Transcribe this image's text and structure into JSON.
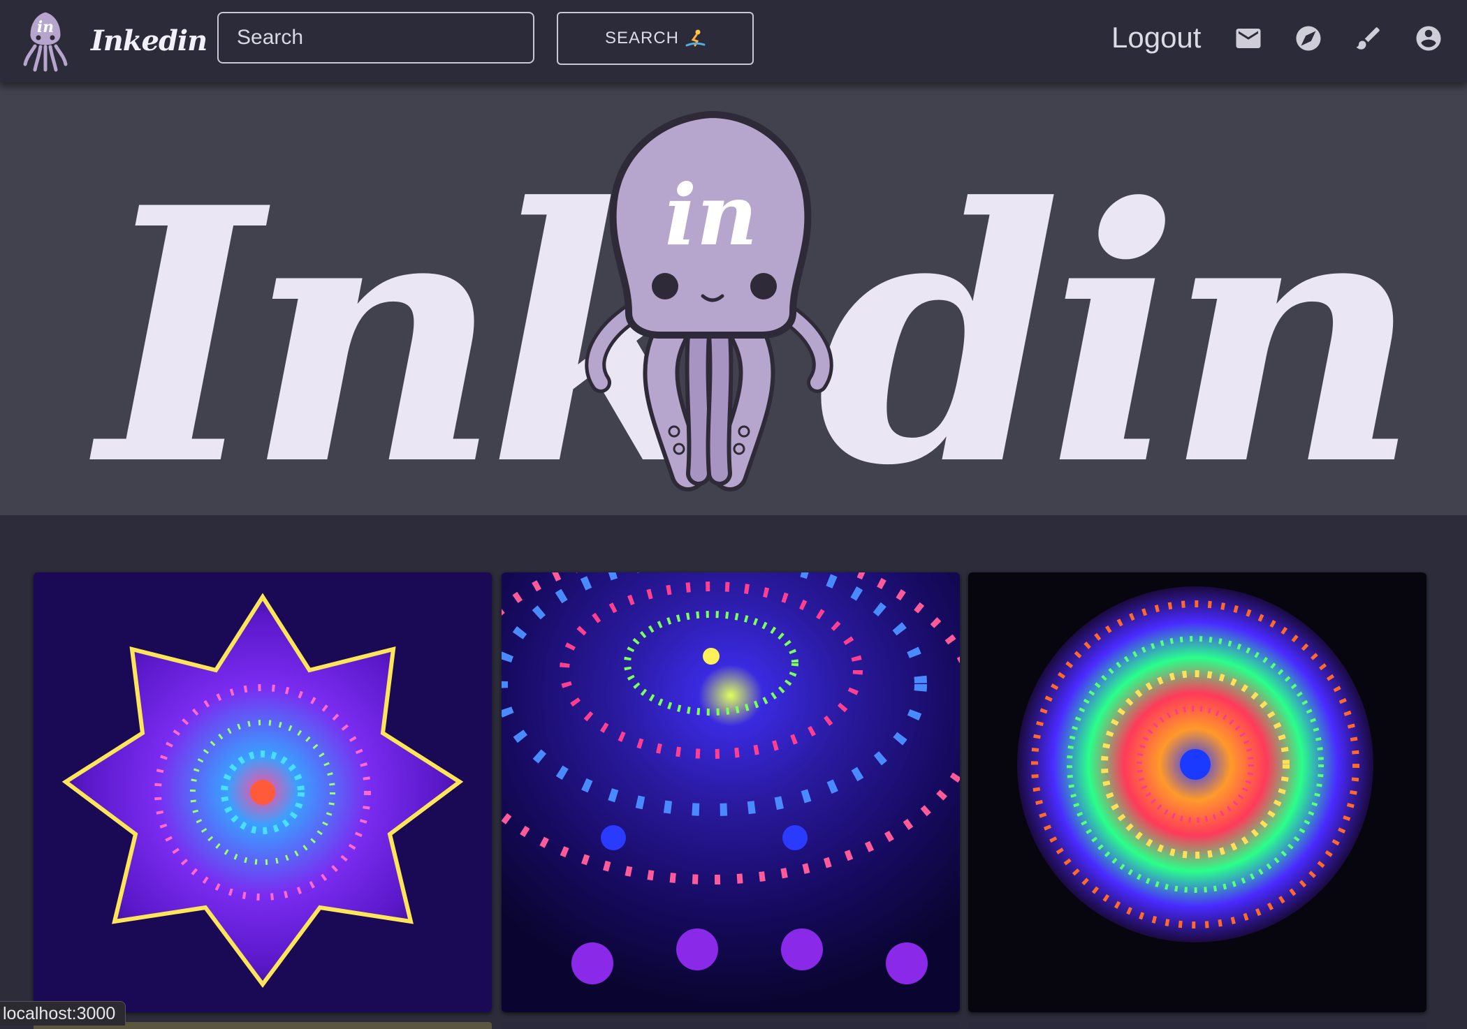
{
  "header": {
    "brand_name": "Inkedin",
    "search_placeholder": "Search",
    "search_button_label": "SEARCH",
    "logout_label": "Logout",
    "icons": [
      "mail-icon",
      "compass-icon",
      "brush-icon",
      "account-circle-icon"
    ]
  },
  "hero": {
    "wordmark_left": "Ink",
    "wordmark_right": "din",
    "mascot_text": "in"
  },
  "gallery": {
    "items": [
      {
        "name": "purple-flower-mandala",
        "colors": [
          "#4a16b8",
          "#8d2ee8",
          "#ff3fa4",
          "#ffe65a"
        ]
      },
      {
        "name": "glowing-dot-mandala",
        "colors": [
          "#1a0a6a",
          "#3a2ae0",
          "#7cff5a",
          "#ff3f8f"
        ]
      },
      {
        "name": "neon-geometric-mandala",
        "colors": [
          "#0a0814",
          "#3a2aff",
          "#ff9a2a",
          "#2aff8a"
        ]
      }
    ]
  },
  "status_bar": {
    "url": "localhost:3000"
  },
  "colors": {
    "topbar": "#2b2b39",
    "hero_bg": "#42424f",
    "wordmark": "#ebe6f4",
    "mascot": "#b6a5cc"
  }
}
